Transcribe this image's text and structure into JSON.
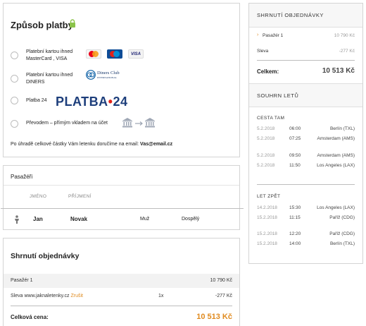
{
  "payment": {
    "title": "Způsob platby",
    "options": [
      {
        "label_line1": "Platební kartou ihned",
        "label_line2": "MasterCard , VISA"
      },
      {
        "label_line1": "Platební kartou ihned",
        "label_line2": "DINERS"
      },
      {
        "label_line1": "Platba 24",
        "label_line2": ""
      },
      {
        "label_line1": "Převodem – přímým vkladem na účet",
        "label_line2": ""
      }
    ],
    "platba_logo": "PLATBA",
    "platba_dot": "•",
    "platba_num": "24",
    "card_logos": [
      "MasterCard",
      "Maestro",
      "VISA"
    ],
    "diners_text": "Diners Club",
    "diners_sub": "INTERNATIONAL",
    "note_prefix": "Po úhradě celkové částky Vám letenku doručíme na email:",
    "note_email": "Vas@email.cz"
  },
  "passengers": {
    "title": "Pasažéři",
    "col_first": "JMÉNO",
    "col_last": "PŘÍJMENÍ",
    "rows": [
      {
        "first": "Jan",
        "last": "Novak",
        "gender": "Muž",
        "type": "Dospělý"
      }
    ]
  },
  "summary": {
    "title": "Shrnutí objednávky",
    "row1_label": "Pasažér 1",
    "row1_price": "10 790 Kč",
    "row2_label": "Sleva www.jaknaletenky.cz",
    "row2_link": "Zrušit",
    "row2_qty": "1x",
    "row2_price": "-277 Kč",
    "total_label": "Celková cena:",
    "total_price": "10 513 Kč"
  },
  "side": {
    "head1": "SHRNUTÍ OBJEDNÁVKY",
    "pax_label": "Pasažér 1",
    "pax_price": "10 790 Kč",
    "discount_label": "Sleva",
    "discount_price": "-277 Kč",
    "total_label": "Celkem:",
    "total_price": "10 513 Kč",
    "head2": "SOUHRN LETŮ",
    "out_label": "CESTA TAM",
    "out_flights": [
      {
        "date": "5.2.2018",
        "time": "06:00",
        "city": "Berlín (TXL)"
      },
      {
        "date": "5.2.2018",
        "time": "07:25",
        "city": "Amsterdam (AMS)"
      },
      {
        "date": "5.2.2018",
        "time": "09:50",
        "city": "Amsterdam (AMS)"
      },
      {
        "date": "5.2.2018",
        "time": "11:50",
        "city": "Los Angeles (LAX)"
      }
    ],
    "ret_label": "LET ZPĚT",
    "ret_flights": [
      {
        "date": "14.2.2018",
        "time": "15:30",
        "city": "Los Angeles (LAX)"
      },
      {
        "date": "15.2.2018",
        "time": "11:15",
        "city": "Paříž (CDG)"
      },
      {
        "date": "15.2.2018",
        "time": "12:20",
        "city": "Paříž (CDG)"
      },
      {
        "date": "15.2.2018",
        "time": "14:00",
        "city": "Berlín (TXL)"
      }
    ]
  },
  "colors": {
    "accent": "#e08a1e",
    "platba_blue": "#1d3e7b",
    "lock_green": "#8bc34a"
  }
}
